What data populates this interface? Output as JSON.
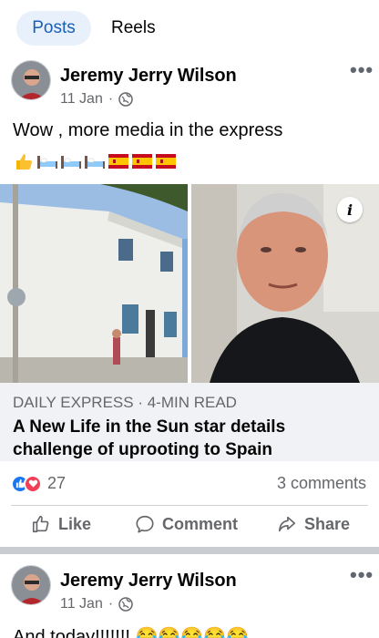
{
  "tabs": [
    {
      "label": "Posts",
      "active": true
    },
    {
      "label": "Reels",
      "active": false
    }
  ],
  "post1": {
    "author": "Jeremy Jerry Wilson",
    "date": "11 Jan",
    "dot": "·",
    "audience_icon": "globe-icon",
    "more_label": "•••",
    "text": "Wow , more media in the express",
    "emojis": [
      "thumbs-up",
      "bed",
      "bed",
      "bed",
      "spain-flag",
      "spain-flag",
      "spain-flag"
    ],
    "link_card": {
      "source": "DAILY EXPRESS · 4-MIN READ",
      "title": "A New Life in the Sun star details challenge of uprooting to Spain",
      "info_label": "i"
    },
    "reactions": {
      "count": "27",
      "icons": [
        "like-icon",
        "love-icon"
      ]
    },
    "comments": "3 comments",
    "actions": {
      "like": "Like",
      "comment": "Comment",
      "share": "Share"
    }
  },
  "post2": {
    "author": "Jeremy Jerry Wilson",
    "date": "11 Jan",
    "dot": "·",
    "more_label": "•••",
    "text": "And today!!!!!!! 😂😂😂😂😂"
  },
  "colors": {
    "accent": "#1a5fb4",
    "tab_bg": "#e7f0fb",
    "muted": "#65676b",
    "card_bg": "#f0f2f5",
    "like_blue": "#1877f2",
    "love_red": "#f33e58"
  }
}
